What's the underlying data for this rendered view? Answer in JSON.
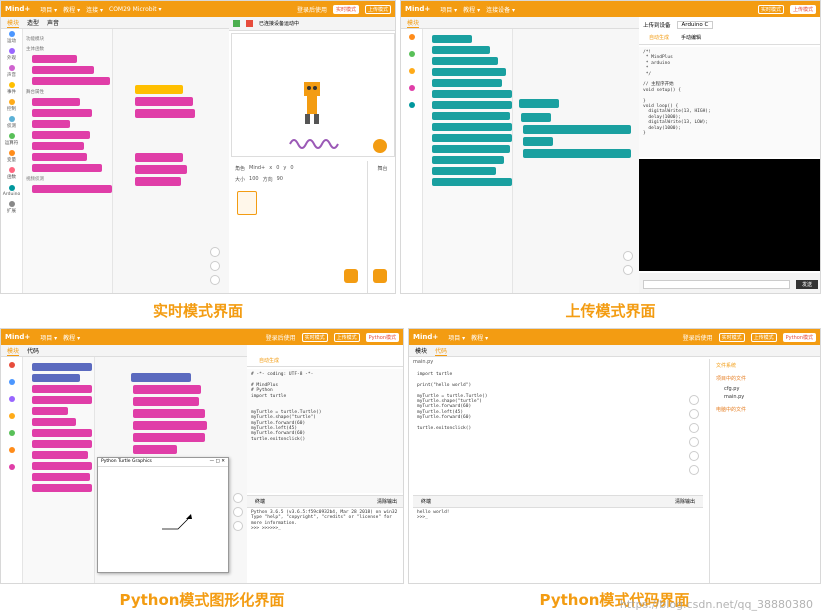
{
  "captions": {
    "realtime": "实时模式界面",
    "upload": "上传模式界面",
    "python_graphic": "Python模式图形化界面",
    "python_code": "Python模式代码界面"
  },
  "watermark": "https://blog.csdn.net/qq_38880380",
  "p1": {
    "logo": "Mind+",
    "menu": [
      "项目 ▾",
      "教程 ▾",
      "连接 ▾",
      "COM29 Microbit ▾"
    ],
    "right": [
      "登录后使用",
      "实时模式",
      "上传模式"
    ],
    "tabs": [
      "模块",
      "造型",
      "声音"
    ],
    "categories": [
      "运动",
      "外观",
      "声音",
      "事件",
      "控制",
      "侦测",
      "运算符",
      "变量",
      "函数",
      "Arduino",
      "扩展"
    ],
    "sections": [
      "功能模块",
      "主体函数",
      "舞台属性",
      "视频侦测"
    ],
    "stage_label": "已连接设备运动中",
    "sprite_label": "角色",
    "sprite_name": "Mind+",
    "stage_area": "舞台",
    "x_label": "x",
    "y_label": "y",
    "size_label": "大小",
    "dir_label": "方向",
    "x": "0",
    "y": "0",
    "size": "100",
    "dir": "90"
  },
  "p2": {
    "logo": "Mind+",
    "menu": [
      "项目 ▾",
      "教程 ▾",
      "连接设备 ▾"
    ],
    "right": [
      "实时模式",
      "上传模式"
    ],
    "tabs": [
      "模块"
    ],
    "device": "Arduino C",
    "upload_btn": "上传到设备",
    "auto_gen": "自动生成",
    "manual_edit": "手动编辑",
    "code": "/*!\n * MindPlus\n * arduino\n *\n */\n\n// 主程序开始\nvoid setup() {\n\n}\nvoid loop() {\n  digitalWrite(13, HIGH);\n  delay(1000);\n  digitalWrite(13, LOW);\n  delay(1000);\n}",
    "serial_btn": "发送"
  },
  "p3": {
    "logo": "Mind+",
    "menu": [
      "项目 ▾",
      "教程 ▾"
    ],
    "right": [
      "登录后使用",
      "实时模式",
      "上传模式",
      "Python模式"
    ],
    "tabs": [
      "模块",
      "代码"
    ],
    "auto_gen": "自动生成",
    "code": "# -*- coding: UTF-8 -*-\n\n# MindPlus\n# Python\nimport turtle\n\n\nmyTurtle = turtle.Turtle()\nmyTurtle.shape(\"turtle\")\nmyTurtle.forward(60)\nmyTurtle.left(45)\nmyTurtle.forward(60)\nturtle.exitonclick()",
    "turtle_title": "Python Turtle Graphics",
    "terminal_title": "终端",
    "clear_label": "清除输出",
    "terminal_text": "Python 3.6.5 (v3.6.5:f59c0932b4, Mar 28 2018) on win32\nType \"help\", \"copyright\", \"credits\" or \"license\" for\nmore information.\n>>> >>>>>>_"
  },
  "p4": {
    "logo": "Mind+",
    "menu": [
      "项目 ▾",
      "教程 ▾"
    ],
    "right": [
      "登录后使用",
      "实时模式",
      "上传模式",
      "Python模式"
    ],
    "tabs": [
      "模块",
      "代码"
    ],
    "file_tab": "main.py",
    "code": "import turtle\n\nprint(\"hello world\")\n\nmyTurtle = turtle.Turtle()\nmyTurtle.shape(\"turtle\")\nmyTurtle.forward(60)\nmyTurtle.left(45)\nmyTurtle.forward(60)\n\nturtle.exitonclick()",
    "file_panel": "文件系统",
    "project_files": "项目中的文件",
    "pc_files": "电脑中的文件",
    "files": [
      "cfg.py",
      "main.py"
    ],
    "terminal_title": "终端",
    "clear_label": "清除输出",
    "terminal_text": "hello world!\n>>>_"
  },
  "colors": {
    "accent": "#f39c12",
    "blue": "#4c97ff",
    "magenta": "#e03ea8",
    "teal": "#1abc9c"
  }
}
